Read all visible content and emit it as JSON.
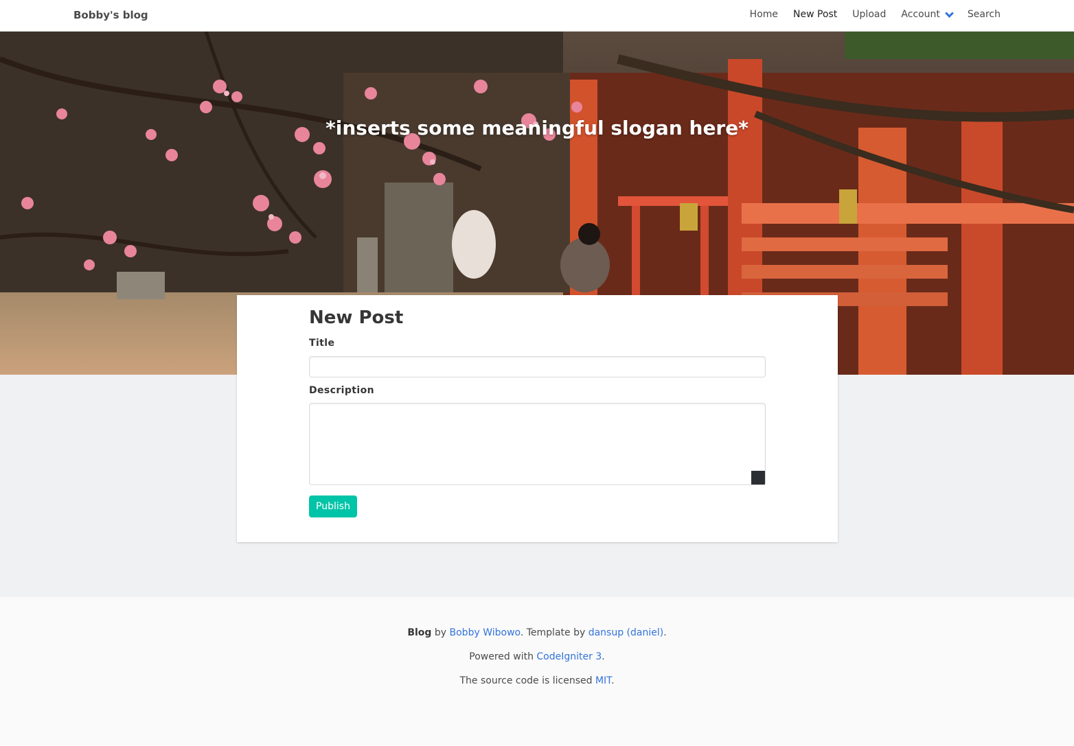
{
  "navbar": {
    "brand": "Bobby's blog",
    "items": [
      {
        "label": "Home"
      },
      {
        "label": "New Post"
      },
      {
        "label": "Upload"
      },
      {
        "label": "Account"
      },
      {
        "label": "Search"
      }
    ]
  },
  "hero": {
    "slogan": "*inserts some meaningful slogan here*"
  },
  "form": {
    "heading": "New Post",
    "title_label": "Title",
    "title_value": "",
    "description_label": "Description",
    "description_value": "",
    "publish_label": "Publish"
  },
  "footer": {
    "line1": {
      "strong": "Blog",
      "by": " by ",
      "author": "Bobby Wibowo",
      "template_by": ". Template by ",
      "template_author": "dansup (daniel)",
      "end": "."
    },
    "line2": {
      "prefix": "Powered with ",
      "link": "CodeIgniter 3",
      "end": "."
    },
    "line3": {
      "prefix": "The source code is licensed ",
      "link": "MIT",
      "end": "."
    }
  },
  "colors": {
    "accent": "#3273dc",
    "publish": "#00c4a7",
    "page_bg": "#f0f1f3",
    "footer_bg": "#fafafa"
  },
  "icons": {
    "account_dropdown": "chevron-down-icon"
  }
}
